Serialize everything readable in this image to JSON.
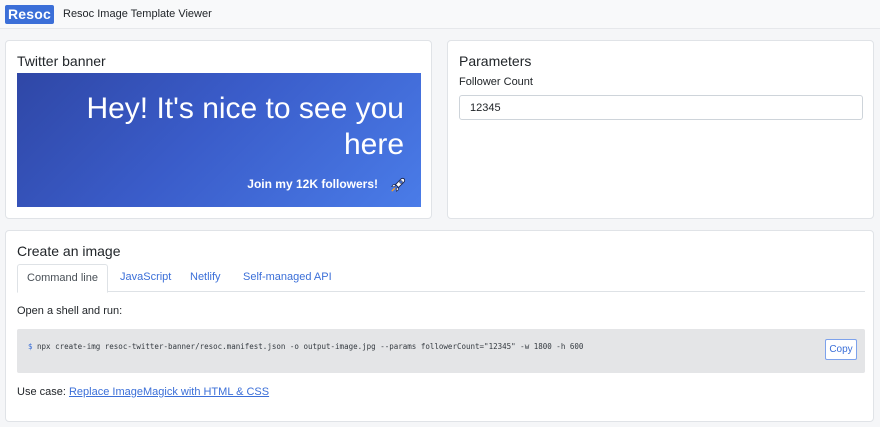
{
  "navbar": {
    "logo_text": "Resoc",
    "title": "Resoc Image Template Viewer"
  },
  "preview": {
    "title": "Twitter banner",
    "banner": {
      "headline": "Hey! It's nice to see you here",
      "subline": "Join my 12K followers!",
      "icon": "rocket-icon"
    }
  },
  "parameters": {
    "title": "Parameters",
    "follower_count_label": "Follower Count",
    "follower_count_value": "12345"
  },
  "create": {
    "title": "Create an image",
    "tabs": [
      {
        "label": "Command line",
        "active": true
      },
      {
        "label": "JavaScript",
        "active": false
      },
      {
        "label": "Netlify",
        "active": false
      },
      {
        "label": "Self-managed API",
        "active": false
      }
    ],
    "instruction": "Open a shell and run:",
    "prompt": "$",
    "command": "npx create-img resoc-twitter-banner/resoc.manifest.json -o output-image.jpg --params followerCount=\"12345\" -w 1800 -h 600",
    "copy_label": "Copy",
    "usecase_prefix": "Use case:",
    "usecase_link": "Replace ImageMagick with HTML & CSS"
  },
  "colors": {
    "accent": "#3b6fd8",
    "banner_gradient_start": "#2f47a6",
    "banner_gradient_end": "#4a7ce8",
    "code_background": "#e4e5e7"
  }
}
